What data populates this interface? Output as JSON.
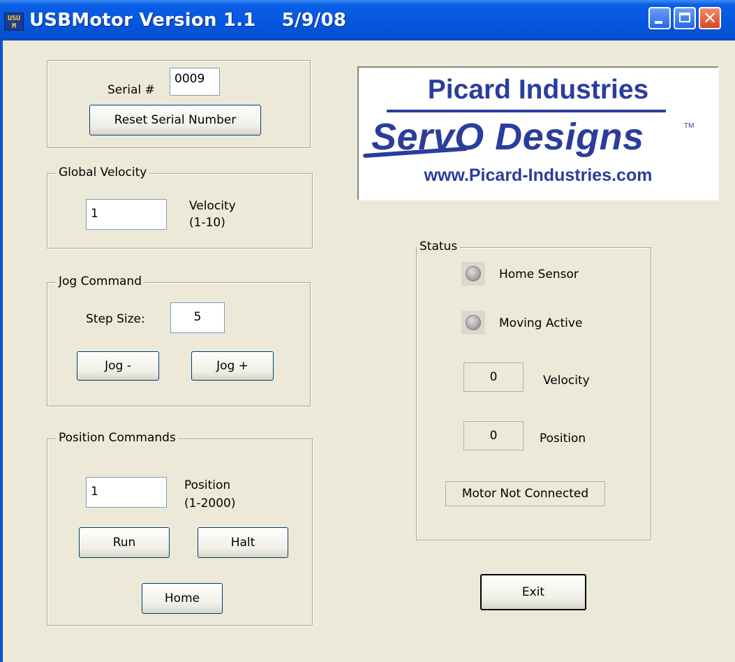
{
  "window": {
    "title": "USBMotor Version 1.1    5/9/08",
    "icon_text": "USU M",
    "controls": [
      "minimize-icon",
      "maximize-icon",
      "close-icon"
    ]
  },
  "serial": {
    "label": "Serial #",
    "value": "0009",
    "reset_label": "Reset Serial Number"
  },
  "global_velocity": {
    "group_label": "Global Velocity",
    "value": "1",
    "label_line1": "Velocity",
    "label_line2": "(1-10)"
  },
  "jog": {
    "group_label": "Jog Command",
    "step_label": "Step Size:",
    "step_value": "5",
    "jog_minus": "Jog -",
    "jog_plus": "Jog +"
  },
  "position": {
    "group_label": "Position Commands",
    "value": "1",
    "label_line1": "Position",
    "label_line2": "(1-2000)",
    "run": "Run",
    "halt": "Halt",
    "home": "Home"
  },
  "logo": {
    "company": "Picard Industries",
    "brand": "ServO Designs",
    "tm": "TM",
    "url": "www.Picard-Industries.com",
    "color": "#2b3d9b"
  },
  "status": {
    "group_label": "Status",
    "home_sensor": "Home Sensor",
    "moving_active": "Moving Active",
    "velocity_value": "0",
    "velocity_label": "Velocity",
    "position_value": "0",
    "position_label": "Position",
    "connection": "Motor Not Connected"
  },
  "exit_label": "Exit",
  "colors": {
    "dialog_bg": "#ece9d8",
    "titlebar": "#0558e0",
    "close_button": "#d8471c"
  }
}
